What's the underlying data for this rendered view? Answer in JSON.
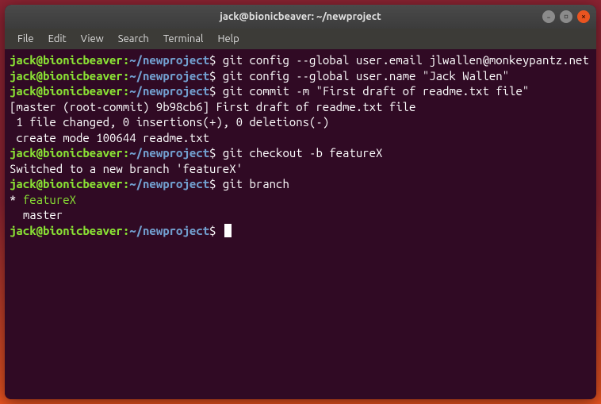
{
  "titlebar": {
    "title": "jack@bionicbeaver: ~/newproject"
  },
  "menubar": {
    "items": [
      "File",
      "Edit",
      "View",
      "Search",
      "Terminal",
      "Help"
    ]
  },
  "prompt": {
    "user_host": "jack@bionicbeaver",
    "colon": ":",
    "path": "~/newproject",
    "dollar": "$"
  },
  "lines": {
    "cmd1": " git config --global user.email jlwallen@monkeypantz.net",
    "cmd2": " git config --global user.name \"Jack Wallen\"",
    "cmd3": " git commit -m \"First draft of readme.txt file\"",
    "out3a": "[master (root-commit) 9b98cb6] First draft of readme.txt file",
    "out3b": " 1 file changed, 0 insertions(+), 0 deletions(-)",
    "out3c": " create mode 100644 readme.txt",
    "cmd4": " git checkout -b featureX",
    "out4": "Switched to a new branch 'featureX'",
    "cmd5": " git branch",
    "out5a_prefix": "* ",
    "out5a_branch": "featureX",
    "out5b": "  master",
    "cmd6": " "
  }
}
